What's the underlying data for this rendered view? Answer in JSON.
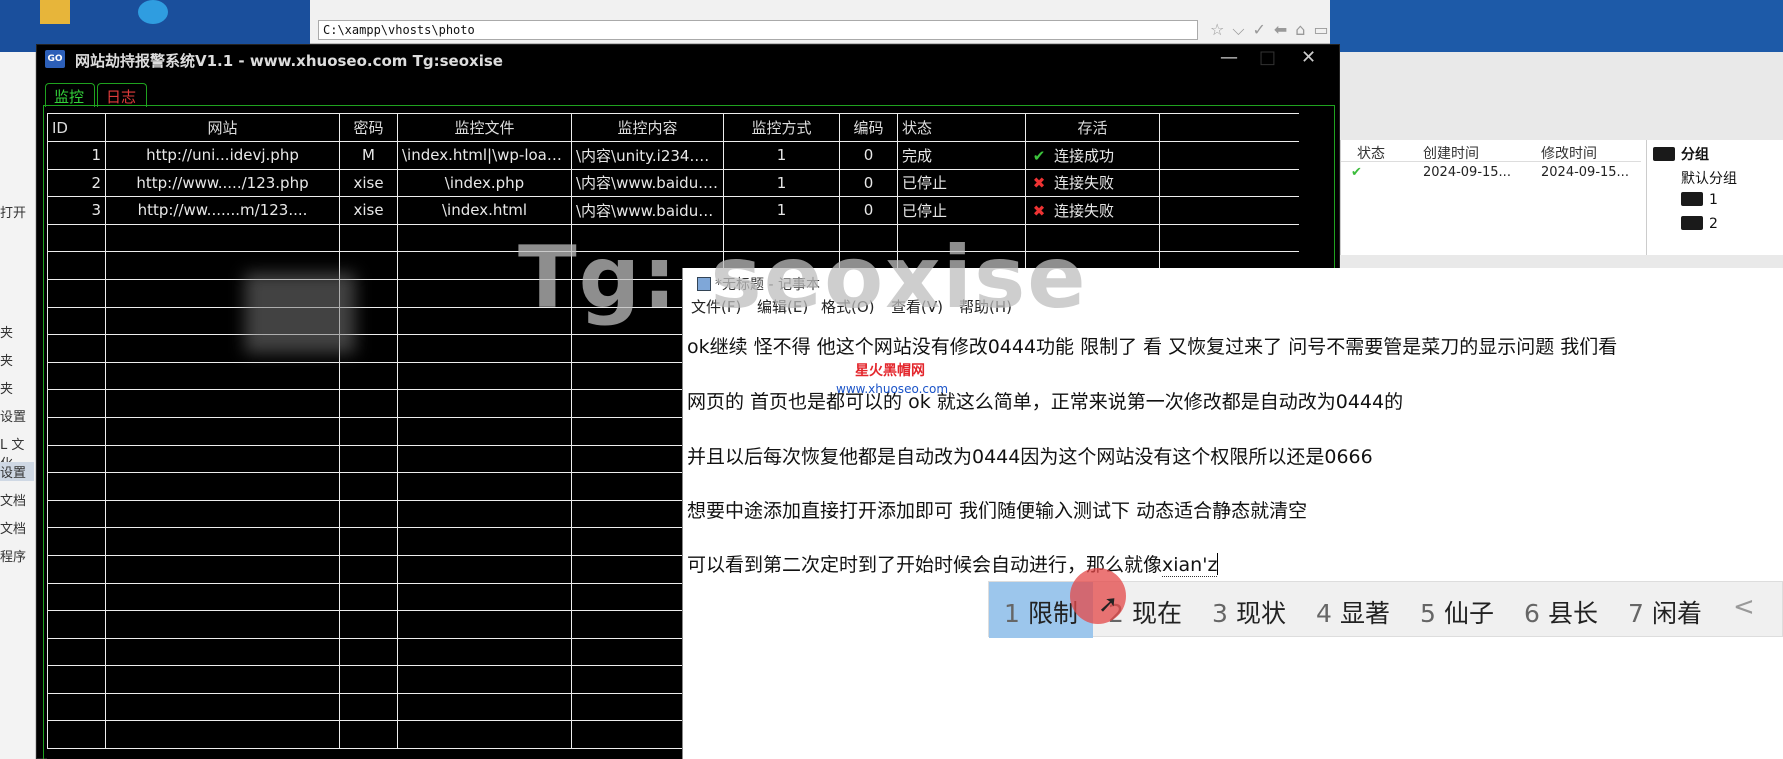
{
  "browser": {
    "address": "C:\\xampp\\vhosts\\photo"
  },
  "left_strip": [
    "夹",
    "夹",
    "夹",
    "设置",
    "L 文化",
    "设置",
    "文档",
    "文档",
    "程序"
  ],
  "left_strip_label": "打开",
  "right_panel": {
    "headers": [
      "状态",
      "创建时间",
      "修改时间"
    ],
    "row": {
      "created": "2024-09-15...",
      "modified": "2024-09-15..."
    },
    "tree": {
      "root": "分组",
      "items": [
        "默认分组",
        "1",
        "2"
      ]
    }
  },
  "monitor_window": {
    "title": "网站劫持报警系统V1.1 - www.xhuoseo.com Tg:seoxise",
    "tabs": [
      "监控",
      "日志"
    ],
    "columns": [
      "ID",
      "网站",
      "密码",
      "监控文件",
      "监控内容",
      "监控方式",
      "编码",
      "状态",
      "存活"
    ],
    "rows": [
      {
        "id": "1",
        "site": "http://uni...idevj.php",
        "password": "M",
        "file": "\\index.html|\\wp-load....",
        "content": "\\内容\\unity.i234.me...",
        "method": "1",
        "encoding": "0",
        "status": "完成",
        "alive": "连接成功",
        "alive_icon": "check-icon"
      },
      {
        "id": "2",
        "site": "http://www...../123.php",
        "password": "xise",
        "file": "\\index.php",
        "content": "\\内容\\www.baidu.c...",
        "method": "1",
        "encoding": "0",
        "status": "已停止",
        "alive": "连接失败",
        "alive_icon": "cross-icon"
      },
      {
        "id": "3",
        "site": "http://ww.......m/123....",
        "password": "xise",
        "file": "\\index.html",
        "content": "\\内容\\www.baidu1...",
        "method": "1",
        "encoding": "0",
        "status": "已停止",
        "alive": "连接失败",
        "alive_icon": "cross-icon"
      }
    ],
    "empty_rows": 19
  },
  "watermark": {
    "big": "Tg: seoxise",
    "red": "星火黑帽网",
    "blue": "www.xhuoseo.com"
  },
  "notepad": {
    "title": "*无标题 - 记事本",
    "menu": [
      "文件(F)",
      "编辑(E)",
      "格式(O)",
      "查看(V)",
      "帮助(H)"
    ],
    "lines": [
      "ok继续      怪不得 他这个网站没有修改0444功能 限制了 看 又恢复过来了 问号不需要管是菜刀的显示问题 我们看",
      "网页的   首页也是都可以的   ok 就这么简单，正常来说第一次修改都是自动改为0444的",
      "并且以后每次恢复他都是自动改为0444因为这个网站没有这个权限所以还是0666",
      "想要中途添加直接打开添加即可 我们随便输入测试下 动态适合静态就清空",
      "可以看到第二次定时到了开始时候会自动进行，那么就像"
    ],
    "typing": "xian'z"
  },
  "ime": {
    "candidates": [
      {
        "n": "1",
        "t": "限制"
      },
      {
        "n": "2",
        "t": "现在"
      },
      {
        "n": "3",
        "t": "现状"
      },
      {
        "n": "4",
        "t": "显著"
      },
      {
        "n": "5",
        "t": "仙子"
      },
      {
        "n": "6",
        "t": "县长"
      },
      {
        "n": "7",
        "t": "闲着"
      }
    ],
    "prev": "<"
  }
}
